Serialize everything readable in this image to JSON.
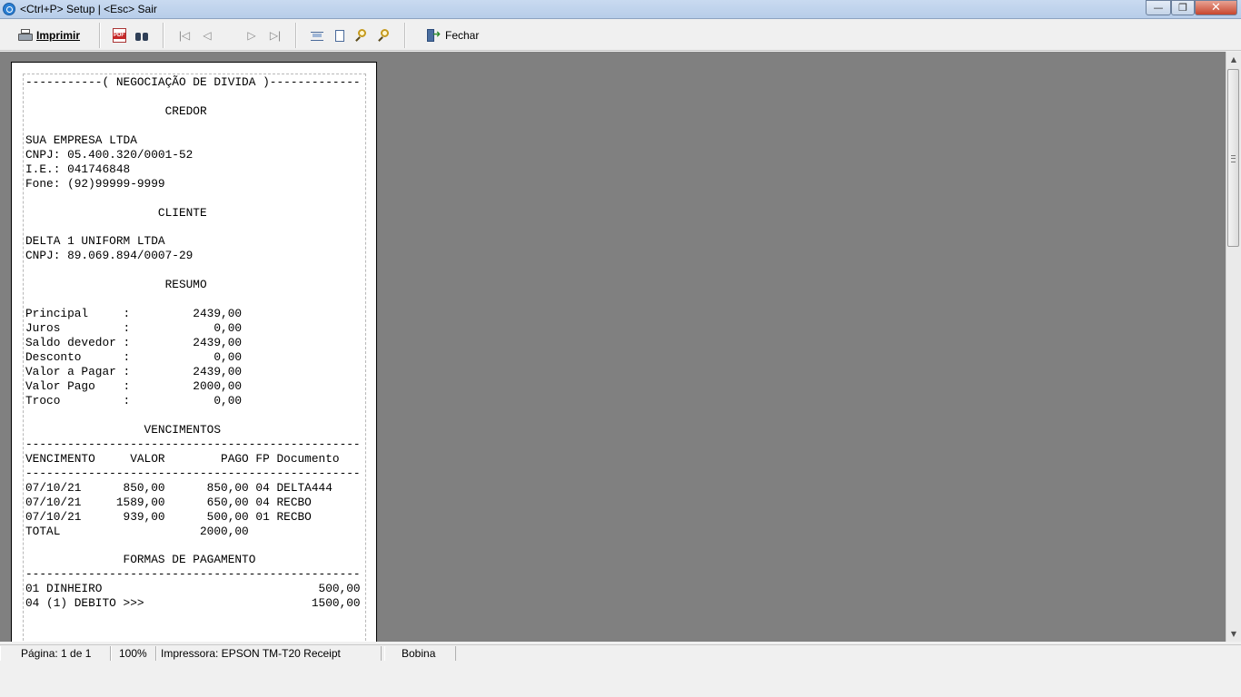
{
  "window": {
    "title": "<Ctrl+P> Setup | <Esc> Sair",
    "minimize_glyph": "—",
    "maximize_glyph": "❐",
    "close_glyph": "✕"
  },
  "toolbar": {
    "print_label": "Imprimir",
    "pdf_icon_text": "PDF",
    "close_label": "Fechar",
    "icons": [
      "printer-icon",
      "pdf-icon",
      "binoculars-icon",
      "first-page-icon",
      "prev-page-icon",
      "next-page-icon",
      "last-page-icon",
      "page-width-icon",
      "whole-page-icon",
      "zoom-in-icon",
      "zoom-out-icon",
      "exit-door-icon"
    ]
  },
  "receipt": {
    "lines": [
      "-----------( NEGOCIAÇÃO DE DIVIDA )-------------",
      "",
      "                    CREDOR",
      "",
      "SUA EMPRESA LTDA",
      "CNPJ: 05.400.320/0001-52",
      "I.E.: 041746848",
      "Fone: (92)99999-9999",
      "",
      "                   CLIENTE",
      "",
      "DELTA 1 UNIFORM LTDA",
      "CNPJ: 89.069.894/0007-29",
      "",
      "                    RESUMO",
      "",
      "Principal     :         2439,00",
      "Juros         :            0,00",
      "Saldo devedor :         2439,00",
      "Desconto      :            0,00",
      "Valor a Pagar :         2439,00",
      "Valor Pago    :         2000,00",
      "Troco         :            0,00",
      "",
      "                 VENCIMENTOS",
      "------------------------------------------------",
      "VENCIMENTO     VALOR        PAGO FP Documento",
      "------------------------------------------------",
      "07/10/21      850,00      850,00 04 DELTA444",
      "07/10/21     1589,00      650,00 04 RECBO",
      "07/10/21      939,00      500,00 01 RECBO",
      "TOTAL                    2000,00",
      "",
      "              FORMAS DE PAGAMENTO",
      "------------------------------------------------",
      "01 DINHEIRO                               500,00",
      "04 (1) DEBITO >>>                        1500,00"
    ]
  },
  "scrollbar": {
    "up_glyph": "▲",
    "down_glyph": "▼"
  },
  "status": {
    "page": "Página: 1 de 1",
    "zoom": "100%",
    "printer": "Impressora: EPSON TM-T20 Receipt",
    "mode": "Bobina"
  }
}
